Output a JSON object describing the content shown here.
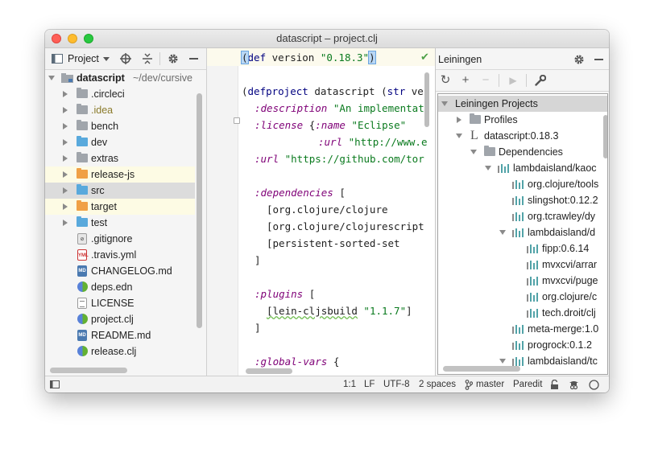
{
  "window": {
    "title": "datascript – project.clj"
  },
  "project_panel": {
    "view_selector": "Project",
    "root": {
      "name": "datascript",
      "path": "~/dev/cursive"
    },
    "items": [
      {
        "label": ".circleci",
        "kind": "folder-gray"
      },
      {
        "label": ".idea",
        "kind": "folder-gray"
      },
      {
        "label": "bench",
        "kind": "folder-gray"
      },
      {
        "label": "dev",
        "kind": "folder-blue"
      },
      {
        "label": "extras",
        "kind": "folder-gray"
      },
      {
        "label": "release-js",
        "kind": "folder-orange"
      },
      {
        "label": "src",
        "kind": "folder-blue"
      },
      {
        "label": "target",
        "kind": "folder-orange"
      },
      {
        "label": "test",
        "kind": "folder-blue"
      },
      {
        "label": ".gitignore",
        "kind": "git-file"
      },
      {
        "label": ".travis.yml",
        "kind": "yml-file"
      },
      {
        "label": "CHANGELOG.md",
        "kind": "md-file"
      },
      {
        "label": "deps.edn",
        "kind": "clj-file"
      },
      {
        "label": "LICENSE",
        "kind": "text-file"
      },
      {
        "label": "project.clj",
        "kind": "clj-file"
      },
      {
        "label": "README.md",
        "kind": "md-file"
      },
      {
        "label": "release.clj",
        "kind": "clj-file"
      }
    ]
  },
  "editor": {
    "lines": {
      "l1a": "(",
      "l1b": "def",
      "l1c": " version ",
      "l1d": "\"0.18.3\"",
      "l1e": ")",
      "l3a": "(",
      "l3b": "defproject",
      "l3c": " datascript (",
      "l3d": "str",
      "l3e": " ve",
      "l4a": ":description",
      "l4b": " \"An implementat",
      "l5a": ":license",
      "l5b": " {",
      "l5c": ":name",
      "l5d": " \"Eclipse\"",
      "l6a": ":url",
      "l6b": " \"http://www.e",
      "l7a": ":url",
      "l7b": " \"https://github.com/tor",
      "l9a": ":dependencies",
      "l9b": " [",
      "l10": "[org.clojure/clojure",
      "l11": "[org.clojure/clojurescript",
      "l12": "[persistent-sorted-set",
      "l13": "]",
      "l15a": ":plugins",
      "l15b": " [",
      "l16a": "[lein-cljsbuild",
      "l16b": " \"1.1.7\"",
      "l16c": "]",
      "l17": "]",
      "l19a": ":global-vars",
      "l19b": " {"
    }
  },
  "leiningen_panel": {
    "title": "Leiningen",
    "tree": {
      "root": "Leiningen Projects",
      "profiles": "Profiles",
      "project": "datascript:0.18.3",
      "dependencies": "Dependencies",
      "dep1": "lambdaisland/kaoc",
      "dep1_1": "org.clojure/tools",
      "dep1_2": "slingshot:0.12.2",
      "dep1_3": "org.tcrawley/dy",
      "dep1_4": "lambdaisland/d",
      "dep1_4_1": "fipp:0.6.14",
      "dep1_4_2": "mvxcvi/arrar",
      "dep1_4_3": "mvxcvi/puge",
      "dep1_4_4": "org.clojure/c",
      "dep1_4_5": "tech.droit/clj",
      "dep1_5": "meta-merge:1.0",
      "dep1_6": "progrock:0.1.2",
      "dep2": "lambdaisland/tc"
    }
  },
  "status_bar": {
    "position": "1:1",
    "line_sep": "LF",
    "encoding": "UTF-8",
    "indent": "2 spaces",
    "branch": "master",
    "mode": "Paredit"
  }
}
